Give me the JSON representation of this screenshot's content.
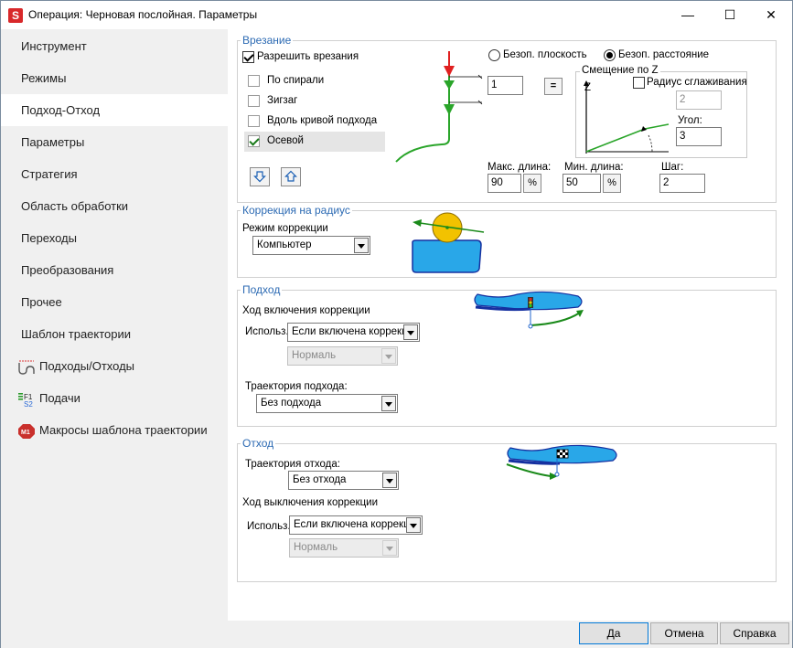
{
  "window": {
    "title": "Операция: Черновая послойная. Параметры",
    "app_icon": "S",
    "minimize": "—",
    "maximize": "☐",
    "close": "✕"
  },
  "sidebar": {
    "items": [
      {
        "label": "Инструмент"
      },
      {
        "label": "Режимы"
      },
      {
        "label": "Подход-Отход",
        "active": true
      },
      {
        "label": "Параметры"
      },
      {
        "label": "Стратегия"
      },
      {
        "label": "Область обработки"
      },
      {
        "label": "Переходы"
      },
      {
        "label": "Преобразования"
      },
      {
        "label": "Прочее"
      },
      {
        "label": "Шаблон траектории"
      },
      {
        "label": "Подходы/Отходы",
        "icon": "approach-path-icon"
      },
      {
        "label": "Подачи",
        "icon": "feeds-icon"
      },
      {
        "label": "Макросы шаблона траектории",
        "icon": "macro-m1-icon"
      }
    ],
    "feeds_icon_text": {
      "f1": "F1",
      "s2": "S2"
    },
    "macro_icon_text": "M1"
  },
  "plunge": {
    "legend": "Врезание",
    "allow_label": "Разрешить врезания",
    "allow_checked": true,
    "options": [
      {
        "label": "По спирали",
        "checked": false
      },
      {
        "label": "Зигзаг",
        "checked": false
      },
      {
        "label": "Вдоль кривой подхода",
        "checked": false
      },
      {
        "label": "Осевой",
        "checked": true
      }
    ],
    "radio_safe_plane": "Безоп. плоскость",
    "radio_safe_distance": "Безоп. расстояние",
    "radio_selected": "safe_distance",
    "distance_value": "1",
    "equals_label": "=",
    "z_offset": {
      "legend": "Смещение по Z",
      "z_axis_label": "Z",
      "smoothing_label": "Радиус сглаживания",
      "smoothing_checked": false,
      "smoothing_value": "2",
      "angle_label": "Угол:",
      "angle_value": "3"
    },
    "max_length_label": "Макс. длина:",
    "max_length_value": "90",
    "min_length_label": "Мин. длина:",
    "min_length_value": "50",
    "step_label": "Шаг:",
    "step_value": "2",
    "percent_label": "%"
  },
  "radius_correction": {
    "legend": "Коррекция на радиус",
    "mode_label": "Режим коррекции",
    "mode_value": "Компьютер"
  },
  "approach": {
    "legend": "Подход",
    "correction_move_label": "Ход включения коррекции",
    "use_label": "Использ.",
    "use_value": "Если включена коррекц",
    "normal_value": "Нормаль",
    "trajectory_label": "Траектория подхода:",
    "trajectory_value": "Без подхода"
  },
  "retract": {
    "legend": "Отход",
    "trajectory_label": "Траектория отхода:",
    "trajectory_value": "Без отхода",
    "correction_move_label": "Ход выключения коррекции",
    "use_label": "Использ.",
    "use_value": "Если включена коррекц",
    "normal_value": "Нормаль"
  },
  "buttons": {
    "ok": "Да",
    "cancel": "Отмена",
    "help": "Справка"
  },
  "colors": {
    "accent_legend": "#2c6ab3",
    "green_path": "#2aa52a",
    "red_arrow": "#e02020",
    "part_blue": "#29a7e8",
    "tool_yellow": "#f2c200"
  }
}
